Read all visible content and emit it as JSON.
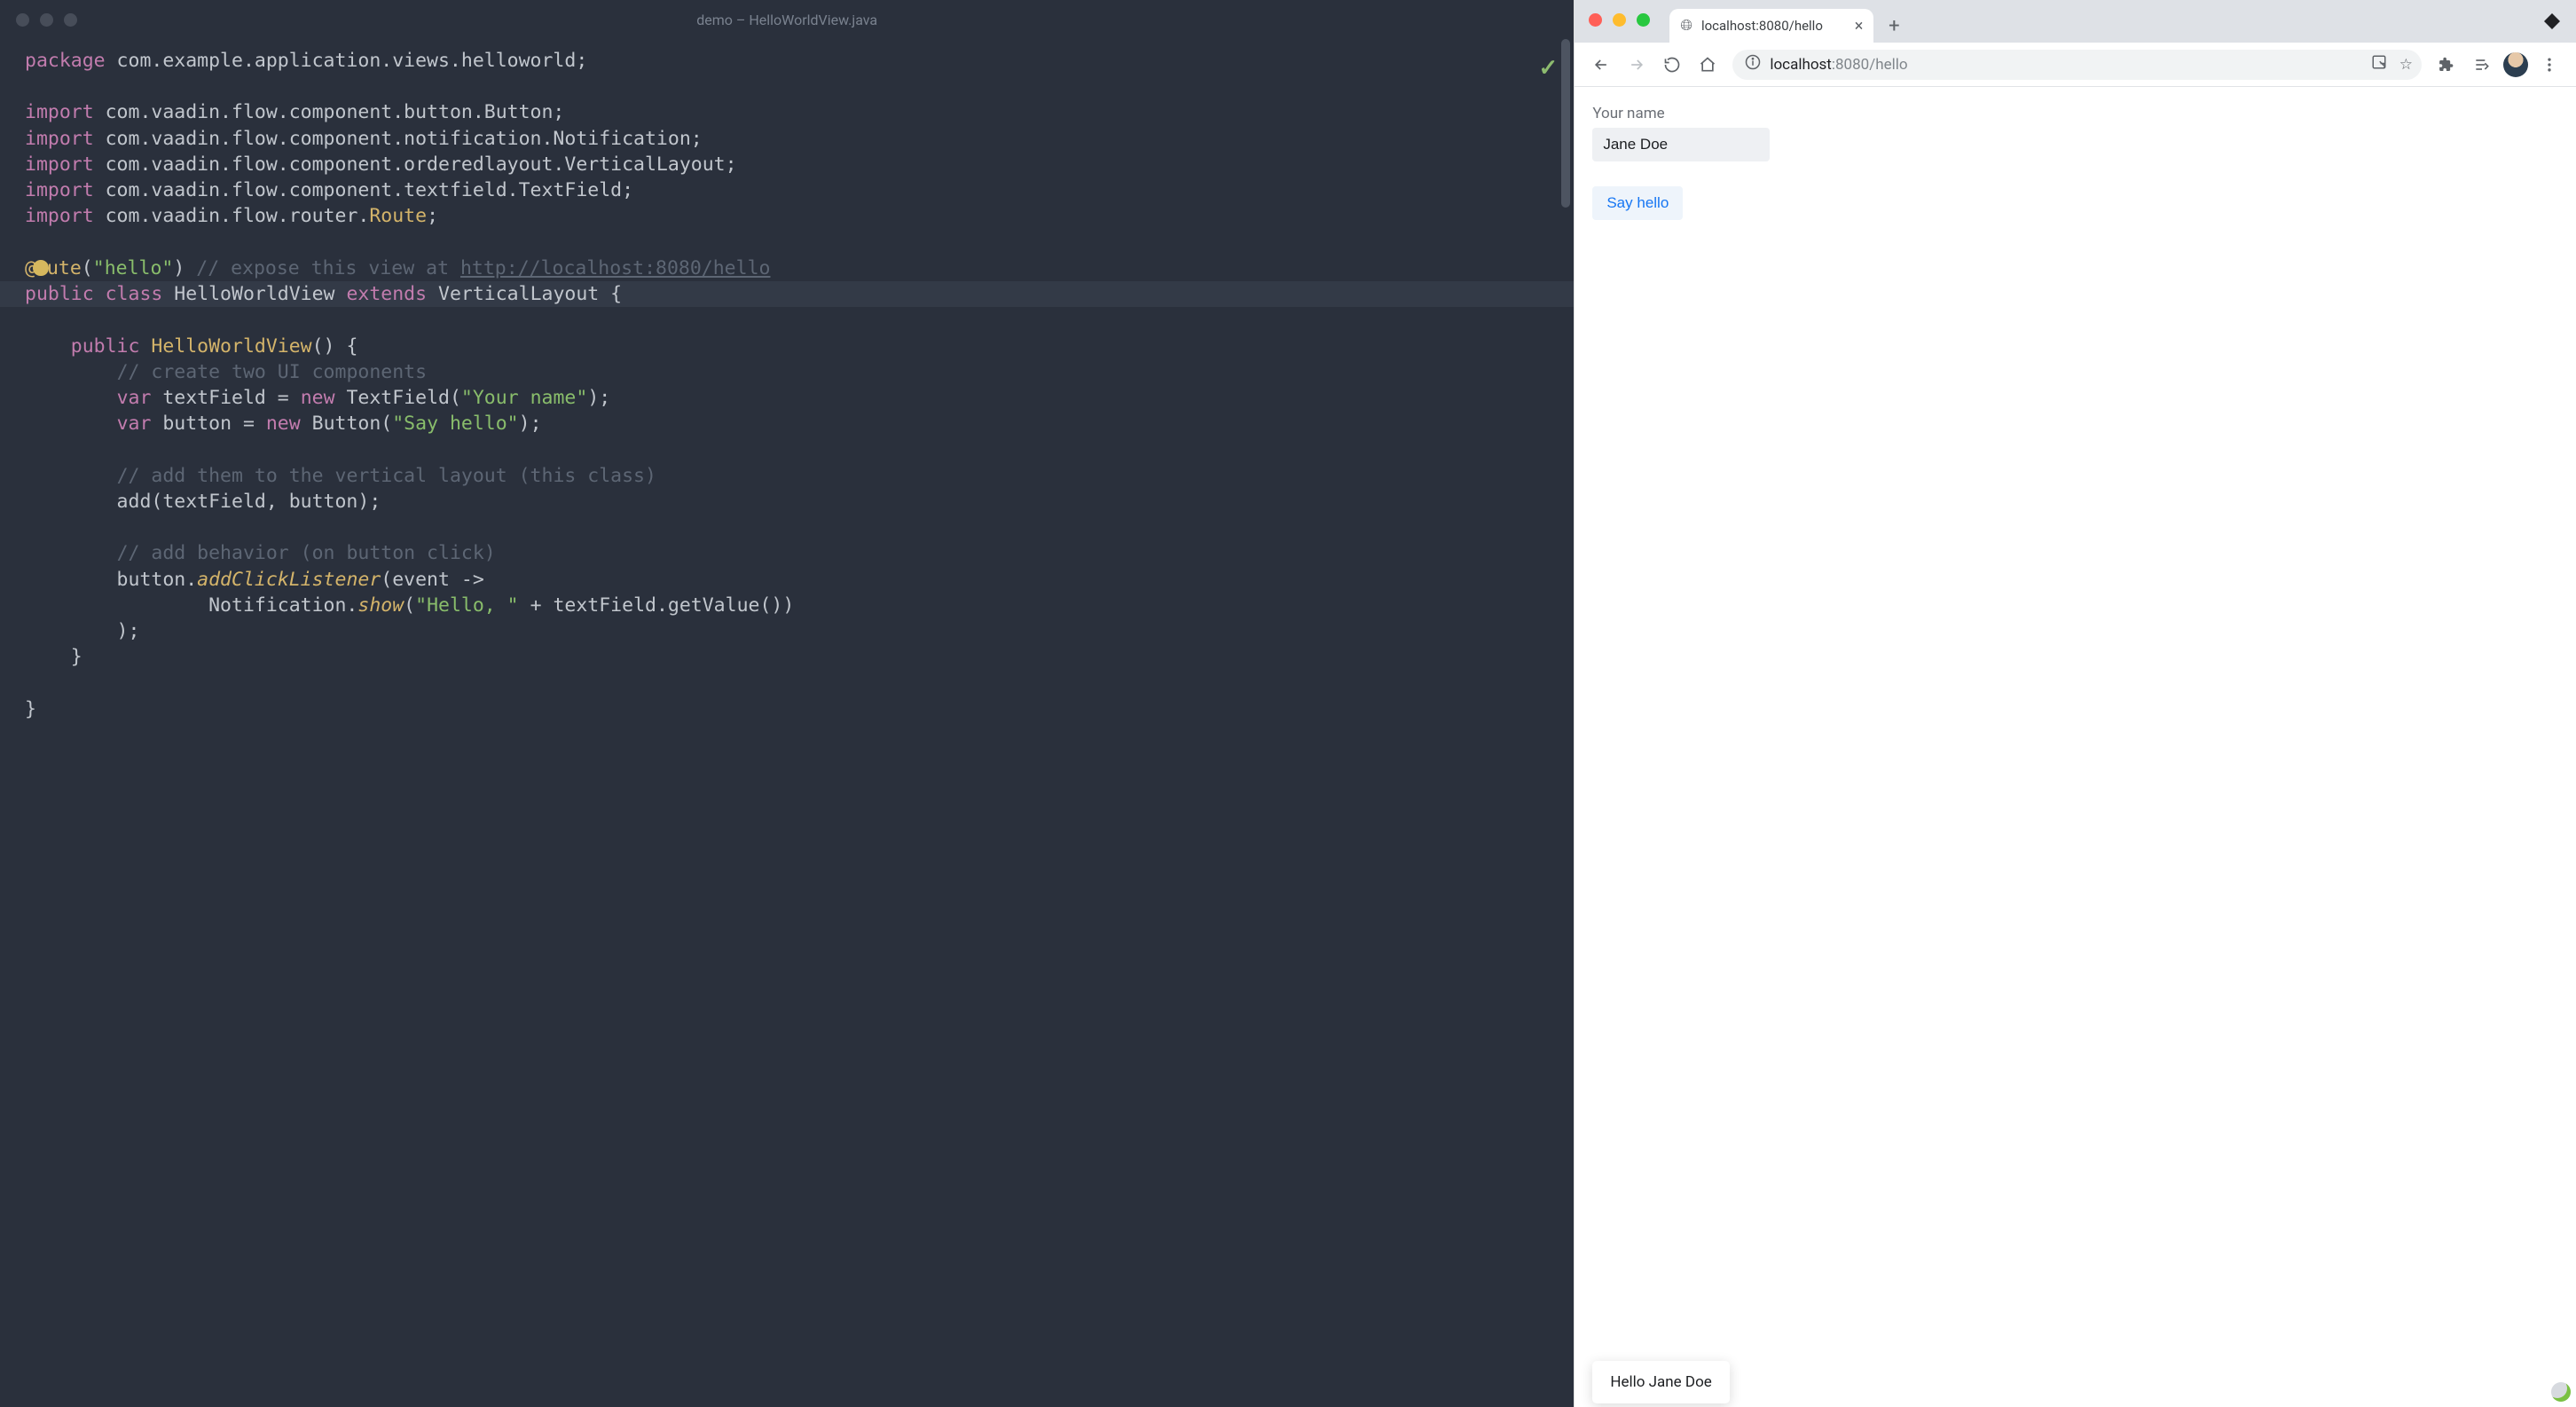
{
  "ide": {
    "title": "demo – HelloWorldView.java",
    "code": {
      "l1_kw": "package",
      "l1_rest": " com.example.application.views.helloworld;",
      "l3_kw": "import",
      "l3_rest": " com.vaadin.flow.component.button.Button;",
      "l4_kw": "import",
      "l4_rest": " com.vaadin.flow.component.notification.Notification;",
      "l5_kw": "import",
      "l5_rest": " com.vaadin.flow.component.orderedlayout.VerticalLayout;",
      "l6_kw": "import",
      "l6_rest": " com.vaadin.flow.component.textfield.TextField;",
      "l7_kw": "import",
      "l7a": " com.vaadin.flow.router.",
      "l7b": "Route",
      "l7c": ";",
      "l9_a": "@",
      "l9_b": "ute",
      "l9_c": "(",
      "l9_str": "\"hello\"",
      "l9_d": ") ",
      "l9_cm": "// expose this view at ",
      "l9_url": "http://localhost:8080/hello",
      "l10_a": "public class ",
      "l10_b": "HelloWorldView ",
      "l10_c": "extends ",
      "l10_d": "VerticalLayout {",
      "l12_a": "    ",
      "l12_b": "public ",
      "l12_c": "HelloWorldView",
      "l12_d": "() {",
      "l13_a": "        ",
      "l13_cm": "// create two UI components",
      "l14_a": "        ",
      "l14_b": "var ",
      "l14_c": "textField = ",
      "l14_d": "new ",
      "l14_e": "TextField(",
      "l14_str": "\"Your name\"",
      "l14_f": ");",
      "l15_a": "        ",
      "l15_b": "var ",
      "l15_c": "button = ",
      "l15_d": "new ",
      "l15_e": "Button(",
      "l15_str": "\"Say hello\"",
      "l15_f": ");",
      "l17_a": "        ",
      "l17_cm": "// add them to the vertical layout (this class)",
      "l18_a": "        add(textField, button);",
      "l20_a": "        ",
      "l20_cm": "// add behavior (on button click)",
      "l21_a": "        button.",
      "l21_call": "addClickListener",
      "l21_b": "(event ->",
      "l22_a": "                Notification.",
      "l22_call": "show",
      "l22_b": "(",
      "l22_str": "\"Hello, \"",
      "l22_c": " + textField.getValue())",
      "l23_a": "        );",
      "l24_a": "    }",
      "l26_a": "}"
    }
  },
  "browser": {
    "tab_title": "localhost:8080/hello",
    "url_host": "localhost",
    "url_rest": ":8080/hello",
    "page": {
      "label": "Your name",
      "input_value": "Jane Doe",
      "button_label": "Say hello",
      "toast": "Hello Jane Doe"
    }
  }
}
